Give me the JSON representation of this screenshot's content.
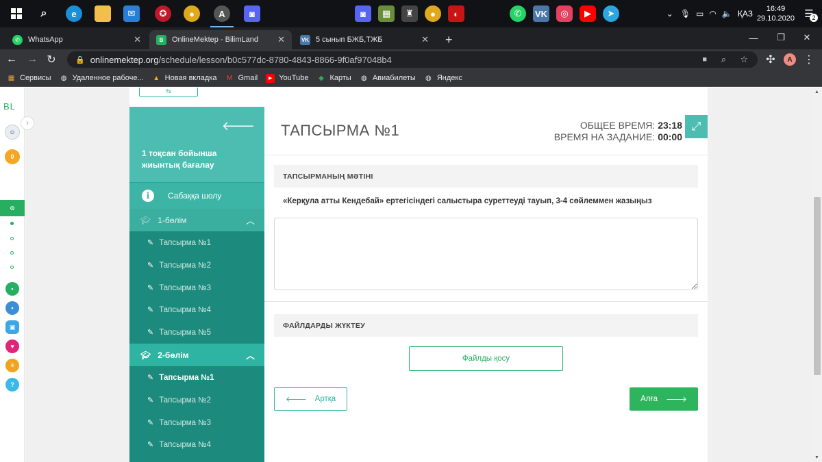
{
  "taskbar": {
    "time": "16:49",
    "date": "29.10.2020",
    "lang": "ҚАЗ",
    "notif_count": "2"
  },
  "browser": {
    "tabs": [
      {
        "title": "WhatsApp",
        "active": false
      },
      {
        "title": "OnlineMektep - BilimLand",
        "active": true
      },
      {
        "title": "5 сынып БЖБ,ТЖБ",
        "active": false
      }
    ],
    "url_host": "onlinemektep.org",
    "url_path": "/schedule/lesson/b0c577dc-8780-4843-8866-9f0af97048b4",
    "profile_initial": "A",
    "bookmarks": [
      "Сервисы",
      "Удаленное рабоче...",
      "Новая вкладка",
      "Gmail",
      "YouTube",
      "Карты",
      "Авиабилеты",
      "Яндекс"
    ]
  },
  "rail": {
    "logo": "BL",
    "badge": "0"
  },
  "sidebar": {
    "title": "1 тоқсан бойынша жиынтық бағалау",
    "overview": "Сабаққа шолу",
    "sections": [
      {
        "label": "1-бөлім",
        "tasks": [
          "Тапсырма №1",
          "Тапсырма №2",
          "Тапсырма №3",
          "Тапсырма №4",
          "Тапсырма №5"
        ]
      },
      {
        "label": "2-бөлім",
        "tasks": [
          "Тапсырма №1",
          "Тапсырма №2",
          "Тапсырма №3",
          "Тапсырма №4"
        ]
      }
    ]
  },
  "main": {
    "title": "ТАПСЫРМА №1",
    "total_time_label": "ОБЩЕЕ ВРЕМЯ:",
    "total_time": "23:18",
    "task_time_label": "ВРЕМЯ НА ЗАДАНИЕ:",
    "task_time": "00:00",
    "text_header": "ТАПСЫРМАНЫҢ МӘТІНІ",
    "prompt": "«Керқула атты Кендебай» ертегісіндегі салыстыра суреттеуді тауып, 3-4 сөйлеммен жазыңыз",
    "answer_value": "",
    "upload_header": "ФАЙЛДАРДЫ ЖҮКТЕУ",
    "add_file": "Файлды қосу",
    "back": "Артқа",
    "next": "Алға"
  }
}
